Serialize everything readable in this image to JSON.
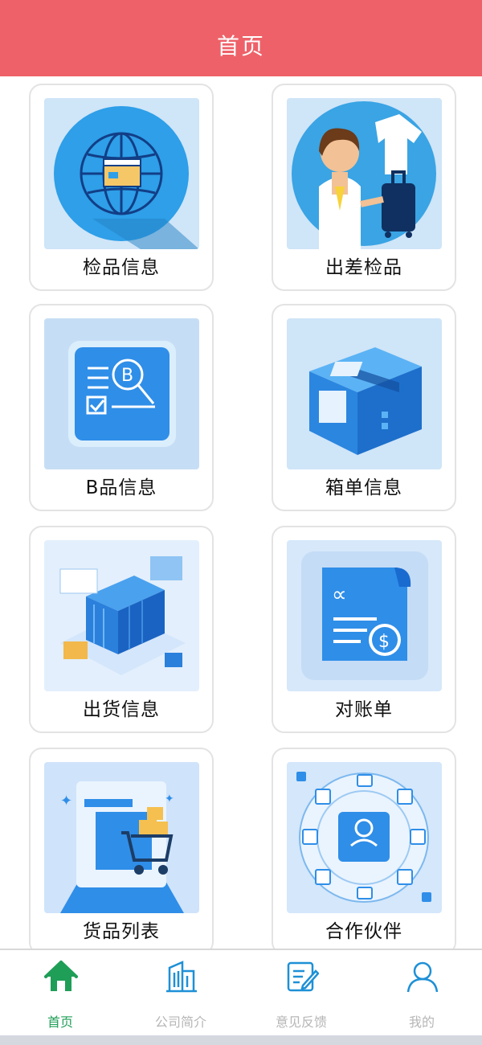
{
  "header": {
    "title": "首页"
  },
  "cards": [
    {
      "label": "检品信息",
      "icon": "globe-box-icon"
    },
    {
      "label": "出差检品",
      "icon": "doctor-luggage-icon"
    },
    {
      "label": "B品信息",
      "icon": "b-document-icon"
    },
    {
      "label": "箱单信息",
      "icon": "package-box-icon"
    },
    {
      "label": "出货信息",
      "icon": "shipping-container-icon"
    },
    {
      "label": "对账单",
      "icon": "invoice-dollar-icon"
    },
    {
      "label": "货品列表",
      "icon": "shopping-cart-icon"
    },
    {
      "label": "合作伙伴",
      "icon": "partner-network-icon"
    }
  ],
  "bottom_nav": [
    {
      "label": "首页",
      "icon": "home-icon",
      "active": true
    },
    {
      "label": "公司简介",
      "icon": "building-icon",
      "active": false
    },
    {
      "label": "意见反馈",
      "icon": "feedback-edit-icon",
      "active": false
    },
    {
      "label": "我的",
      "icon": "user-icon",
      "active": false
    }
  ],
  "colors": {
    "header": "#ee6168",
    "active_nav": "#1f9e57",
    "inactive_nav": "#b6b6b6",
    "icon_blue": "#1e90d6"
  }
}
